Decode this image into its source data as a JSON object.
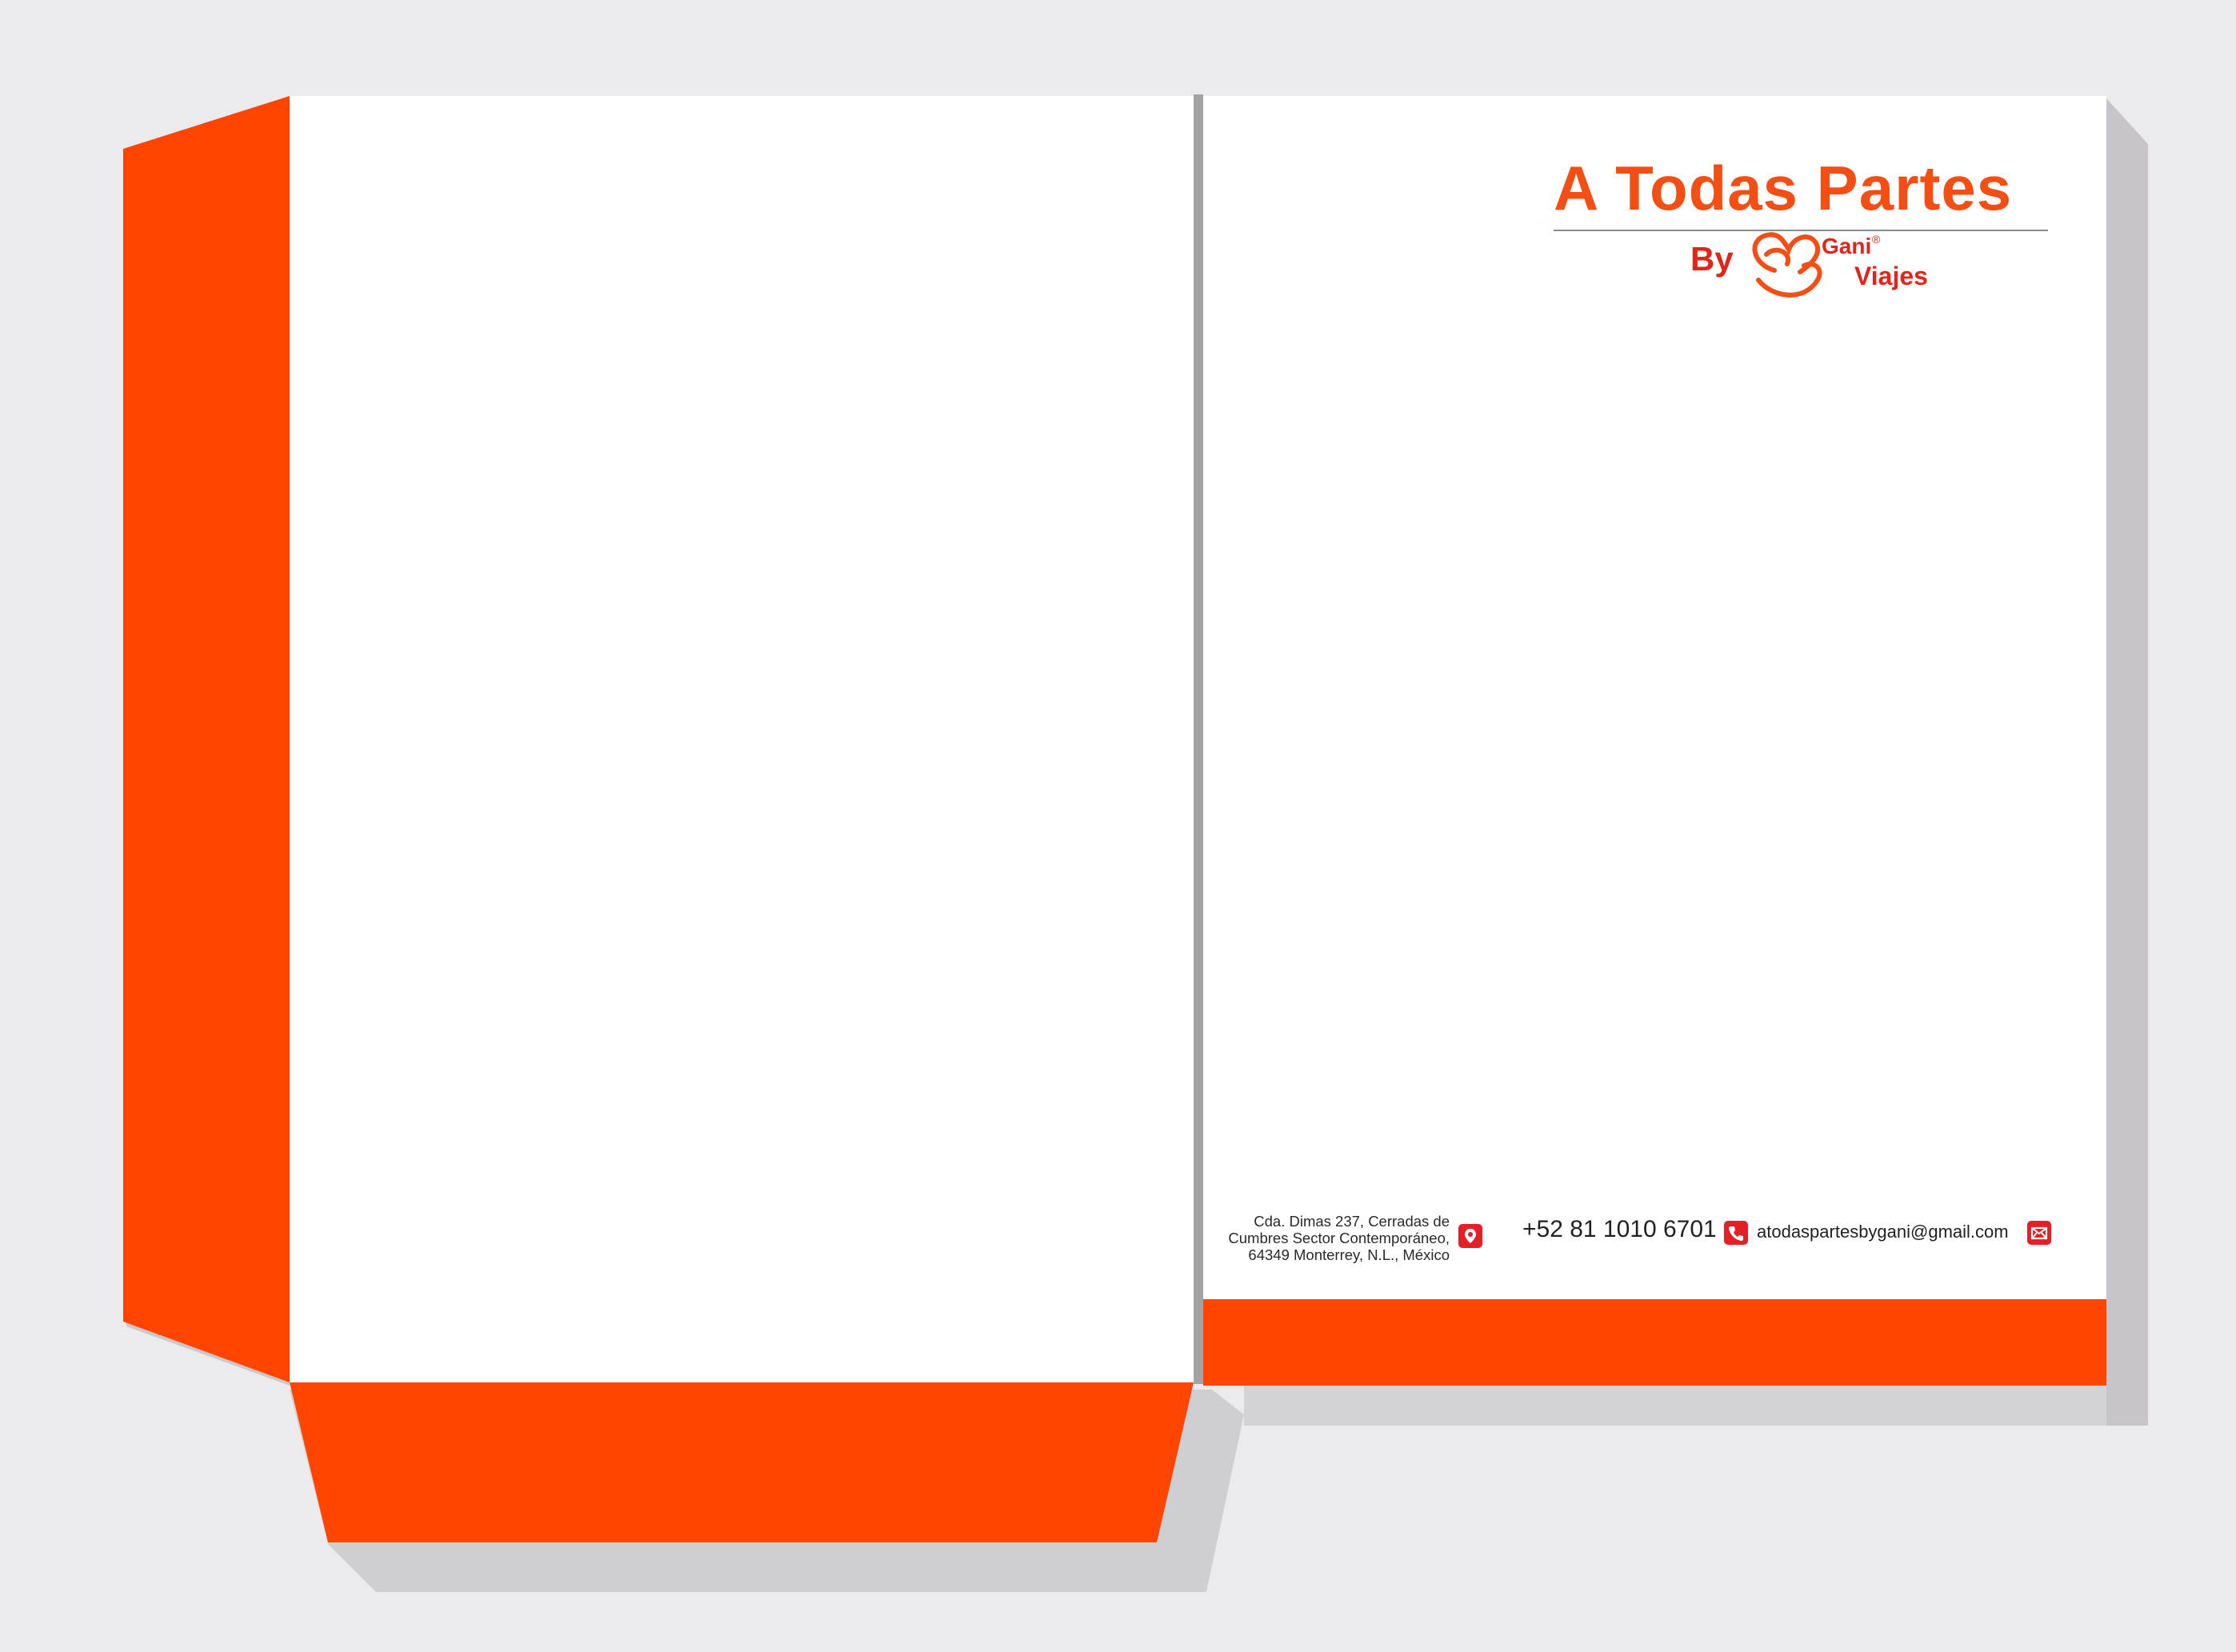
{
  "brand": {
    "title": "A Todas Partes",
    "by": "By",
    "gani": "Gani",
    "registered": "®",
    "viajes": "Viajes"
  },
  "contact": {
    "address_lines": [
      "Cda. Dimas 237, Cerradas de",
      "Cumbres Sector Contemporáneo,",
      "64349 Monterrey, N.L., México"
    ],
    "phone": "+52 81 1010 6701",
    "email": "atodaspartesbygani@gmail.com",
    "icons": [
      "location-pin-icon",
      "phone-icon",
      "envelope-icon"
    ]
  },
  "colors": {
    "accent_orange": "#ff4500",
    "brand_orange": "#f34e13",
    "brand_red": "#e0261a",
    "icon_red": "#e41f26",
    "spine_gray": "#a3a3a3",
    "background": "#ebebed"
  }
}
